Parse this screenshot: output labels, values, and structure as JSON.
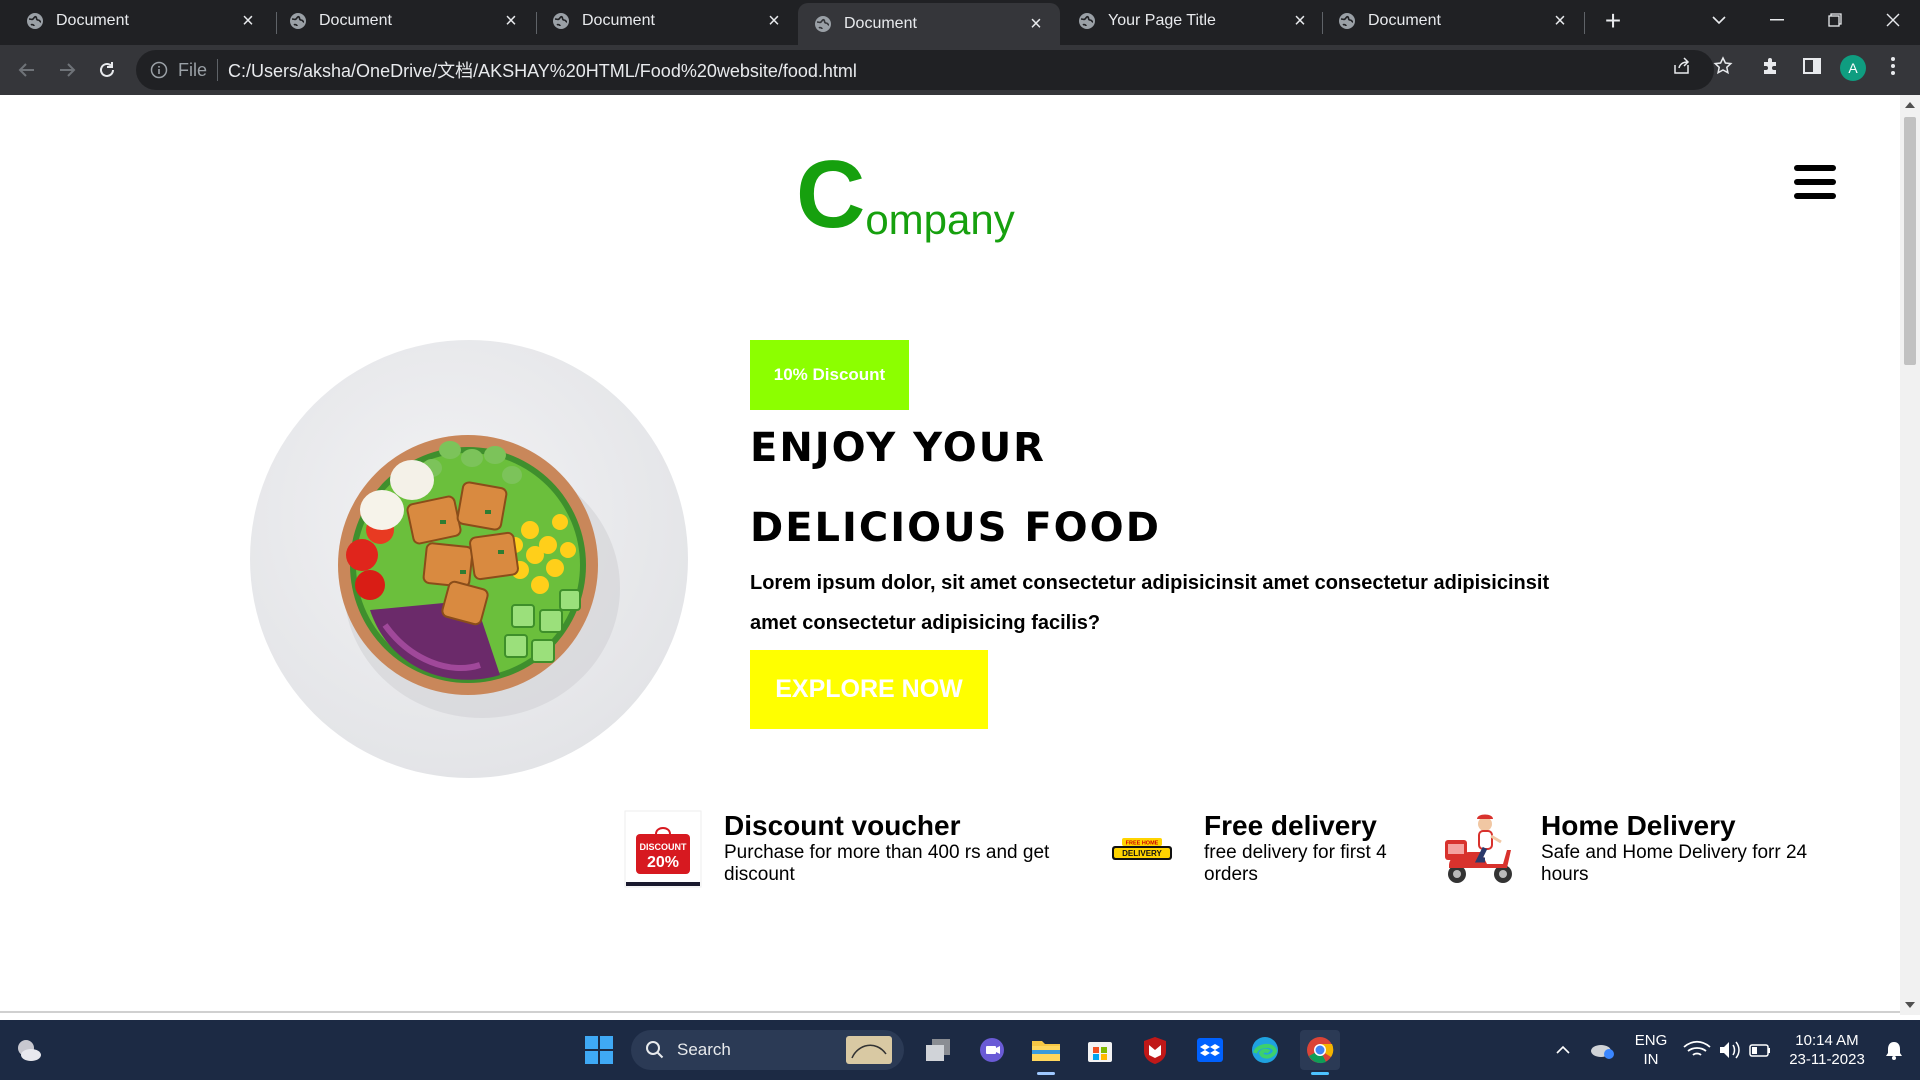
{
  "browser": {
    "tabs": [
      {
        "title": "Document",
        "active": false
      },
      {
        "title": "Document",
        "active": false
      },
      {
        "title": "Document",
        "active": false
      },
      {
        "title": "Document",
        "active": true
      },
      {
        "title": "Your Page Title",
        "active": false
      },
      {
        "title": "Document",
        "active": false
      }
    ],
    "new_tab_label": "+",
    "address": {
      "scheme_label": "File",
      "url": "C:/Users/aksha/OneDrive/文档/AKSHAY%20HTML/Food%20website/food.html"
    },
    "profile_initial": "A"
  },
  "page": {
    "logo": {
      "initial": "C",
      "rest": "ompany",
      "color": "#16a00e"
    },
    "hero": {
      "discount_tag": "10% Discount",
      "headline_line1": "ENJOY YOUR",
      "headline_line2": "DELICIOUS FOOD",
      "description": "Lorem ipsum dolor, sit amet consectetur adipisicinsit amet consectetur adipisicinsit amet consectetur adipisicing facilis?",
      "cta_label": "EXPLORE NOW",
      "image_alt": "salad bowl"
    },
    "features": [
      {
        "icon": "discount-voucher-icon",
        "title": "Discount voucher",
        "desc": "Purchase for more than 400 rs and get discount",
        "badge_text": "DISCOUNT",
        "badge_value": "20%"
      },
      {
        "icon": "free-delivery-icon",
        "title": "Free delivery",
        "desc": "free delivery for first 4 orders",
        "badge_top": "FREE HOME",
        "badge_text": "DELIVERY"
      },
      {
        "icon": "scooter-delivery-icon",
        "title": "Home Delivery",
        "desc": "Safe and Home Delivery forr 24 hours"
      }
    ],
    "colors": {
      "discount_tag": "#8cff00",
      "cta": "#ffff00",
      "logo": "#16a00e"
    }
  },
  "taskbar": {
    "search_placeholder": "Search",
    "language": {
      "line1": "ENG",
      "line2": "IN"
    },
    "time": "10:14 AM",
    "date": "23-11-2023"
  }
}
